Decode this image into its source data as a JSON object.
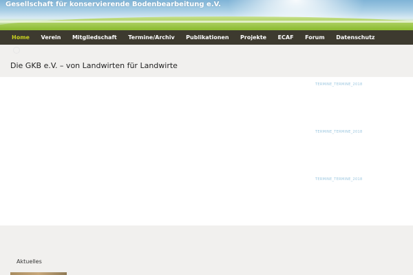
{
  "banner": {
    "title": "Gesellschaft für konservierende Bodenbearbeitung e.V."
  },
  "nav": {
    "items": [
      {
        "label": "Home",
        "active": true
      },
      {
        "label": "Verein"
      },
      {
        "label": "Mitgliedschaft"
      },
      {
        "label": "Termine/Archiv"
      },
      {
        "label": "Publikationen"
      },
      {
        "label": "Projekte"
      },
      {
        "label": "ECAF"
      },
      {
        "label": "Forum"
      },
      {
        "label": "Datenschutz"
      }
    ]
  },
  "subheader": {
    "tagline": "Die GKB e.V. – von Landwirten für Landwirte"
  },
  "content": {
    "events": [
      "TERMINE_TERMINE_2018",
      "TERMINE_TERMINE_2018",
      "TERMINE_TERMINE_2018"
    ]
  },
  "footer": {
    "aktuelles": "Aktuelles"
  },
  "colors": {
    "nav_bg": "#3d3a2f",
    "nav_active": "#c9d21f",
    "page_bg": "#f1f0ee",
    "event_link": "#9ac6df"
  }
}
